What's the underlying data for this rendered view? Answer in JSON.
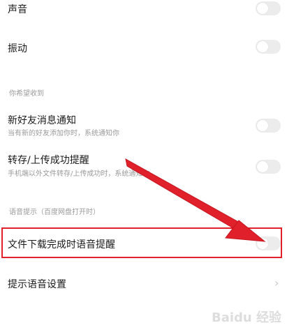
{
  "settings": {
    "sound": {
      "label": "声音",
      "enabled": false
    },
    "vibration": {
      "label": "振动",
      "enabled": false
    },
    "section_hope_receive": "你希望收到",
    "new_friend": {
      "label": "新好友消息通知",
      "subtitle": "当有新的好友添加你时，系统通知你",
      "enabled": false
    },
    "transfer_upload": {
      "label": "转存/上传成功提醒",
      "subtitle": "手机端以外文件转存/上传成功时，系统通知你",
      "enabled": false
    },
    "section_voice": "语音提示（百度网盘打开时）",
    "download_voice": {
      "label": "文件下载完成时语音提醒",
      "enabled": false
    },
    "voice_settings": {
      "label": "提示语音设置"
    }
  },
  "watermark": {
    "text": "Baidu 经验"
  },
  "colors": {
    "annotation_red": "#e0202a",
    "toggle_off": "#ececec"
  }
}
